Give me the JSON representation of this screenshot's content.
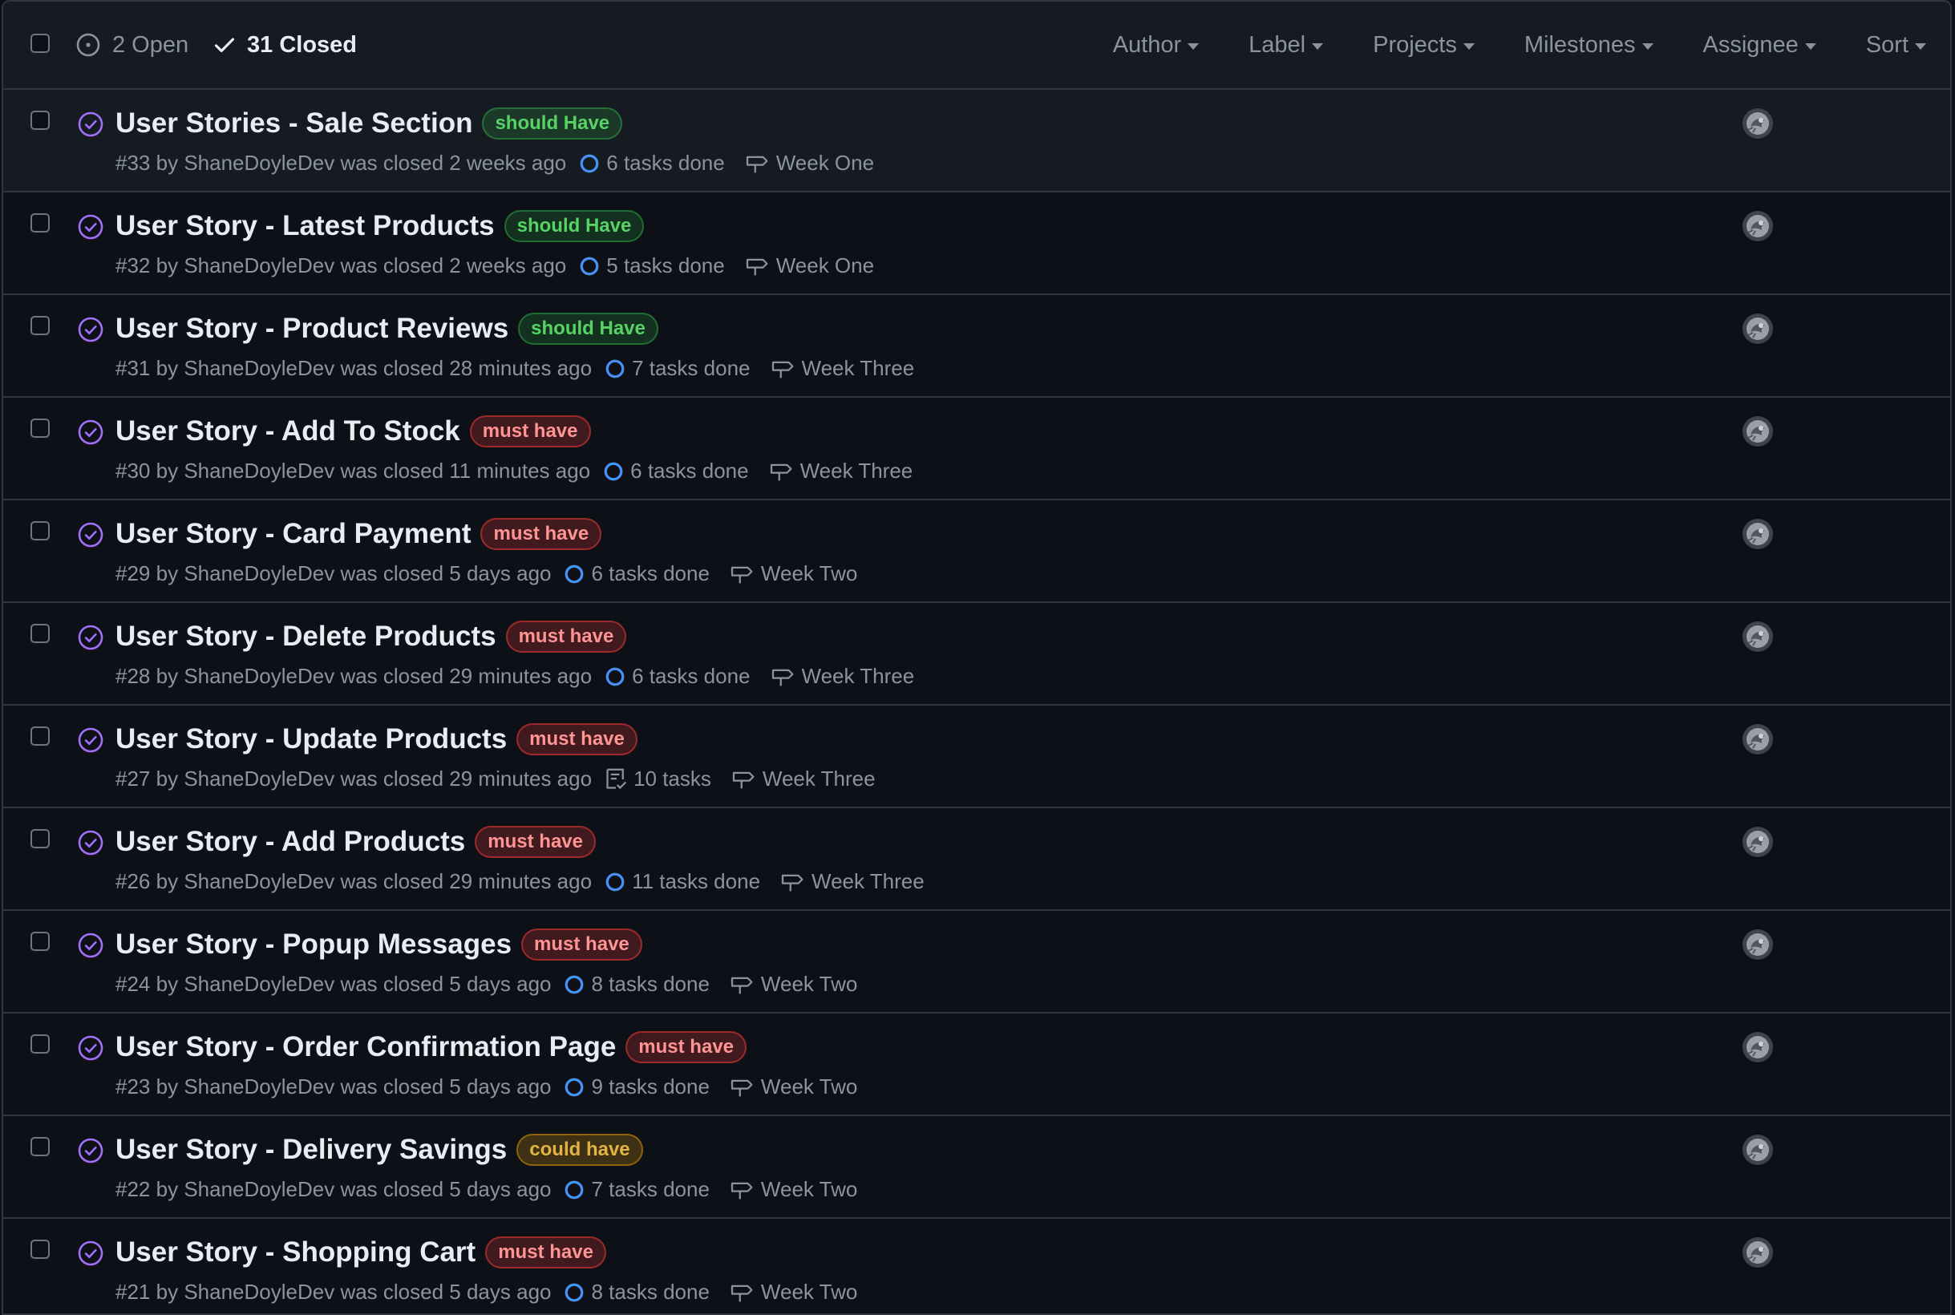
{
  "header": {
    "open_label": "2 Open",
    "closed_label": "31 Closed",
    "filters": [
      "Author",
      "Label",
      "Projects",
      "Milestones",
      "Assignee",
      "Sort"
    ]
  },
  "colors": {
    "background": "#0d1117",
    "header_bg": "#161b22",
    "border": "#30363d",
    "closed_icon": "#a371f7",
    "task_circle": "#4493f8"
  },
  "issues": [
    {
      "title": "User Stories - Sale Section",
      "label": "should Have",
      "label_kind": "should",
      "number": "#33",
      "author": "ShaneDoyleDev",
      "closed": "was closed 2 weeks ago",
      "tasks": "6 tasks done",
      "task_icon": "progress-circle-icon",
      "milestone": "Week One"
    },
    {
      "title": "User Story - Latest Products",
      "label": "should Have",
      "label_kind": "should",
      "number": "#32",
      "author": "ShaneDoyleDev",
      "closed": "was closed 2 weeks ago",
      "tasks": "5 tasks done",
      "task_icon": "progress-circle-icon",
      "milestone": "Week One"
    },
    {
      "title": "User Story - Product Reviews",
      "label": "should Have",
      "label_kind": "should",
      "number": "#31",
      "author": "ShaneDoyleDev",
      "closed": "was closed 28 minutes ago",
      "tasks": "7 tasks done",
      "task_icon": "progress-circle-icon",
      "milestone": "Week Three"
    },
    {
      "title": "User Story - Add To Stock",
      "label": "must have",
      "label_kind": "must",
      "number": "#30",
      "author": "ShaneDoyleDev",
      "closed": "was closed 11 minutes ago",
      "tasks": "6 tasks done",
      "task_icon": "progress-circle-icon",
      "milestone": "Week Three"
    },
    {
      "title": "User Story - Card Payment",
      "label": "must have",
      "label_kind": "must",
      "number": "#29",
      "author": "ShaneDoyleDev",
      "closed": "was closed 5 days ago",
      "tasks": "6 tasks done",
      "task_icon": "progress-circle-icon",
      "milestone": "Week Two"
    },
    {
      "title": "User Story - Delete Products",
      "label": "must have",
      "label_kind": "must",
      "number": "#28",
      "author": "ShaneDoyleDev",
      "closed": "was closed 29 minutes ago",
      "tasks": "6 tasks done",
      "task_icon": "progress-circle-icon",
      "milestone": "Week Three"
    },
    {
      "title": "User Story - Update Products",
      "label": "must have",
      "label_kind": "must",
      "number": "#27",
      "author": "ShaneDoyleDev",
      "closed": "was closed 29 minutes ago",
      "tasks": "10 tasks",
      "task_icon": "checklist-icon",
      "milestone": "Week Three"
    },
    {
      "title": "User Story - Add Products",
      "label": "must have",
      "label_kind": "must",
      "number": "#26",
      "author": "ShaneDoyleDev",
      "closed": "was closed 29 minutes ago",
      "tasks": "11 tasks done",
      "task_icon": "progress-circle-icon",
      "milestone": "Week Three"
    },
    {
      "title": "User Story - Popup Messages",
      "label": "must have",
      "label_kind": "must",
      "number": "#24",
      "author": "ShaneDoyleDev",
      "closed": "was closed 5 days ago",
      "tasks": "8 tasks done",
      "task_icon": "progress-circle-icon",
      "milestone": "Week Two"
    },
    {
      "title": "User Story - Order Confirmation Page",
      "label": "must have",
      "label_kind": "must",
      "number": "#23",
      "author": "ShaneDoyleDev",
      "closed": "was closed 5 days ago",
      "tasks": "9 tasks done",
      "task_icon": "progress-circle-icon",
      "milestone": "Week Two"
    },
    {
      "title": "User Story - Delivery Savings",
      "label": "could have",
      "label_kind": "could",
      "number": "#22",
      "author": "ShaneDoyleDev",
      "closed": "was closed 5 days ago",
      "tasks": "7 tasks done",
      "task_icon": "progress-circle-icon",
      "milestone": "Week Two"
    },
    {
      "title": "User Story - Shopping Cart",
      "label": "must have",
      "label_kind": "must",
      "number": "#21",
      "author": "ShaneDoyleDev",
      "closed": "was closed 5 days ago",
      "tasks": "8 tasks done",
      "task_icon": "progress-circle-icon",
      "milestone": "Week Two"
    }
  ]
}
